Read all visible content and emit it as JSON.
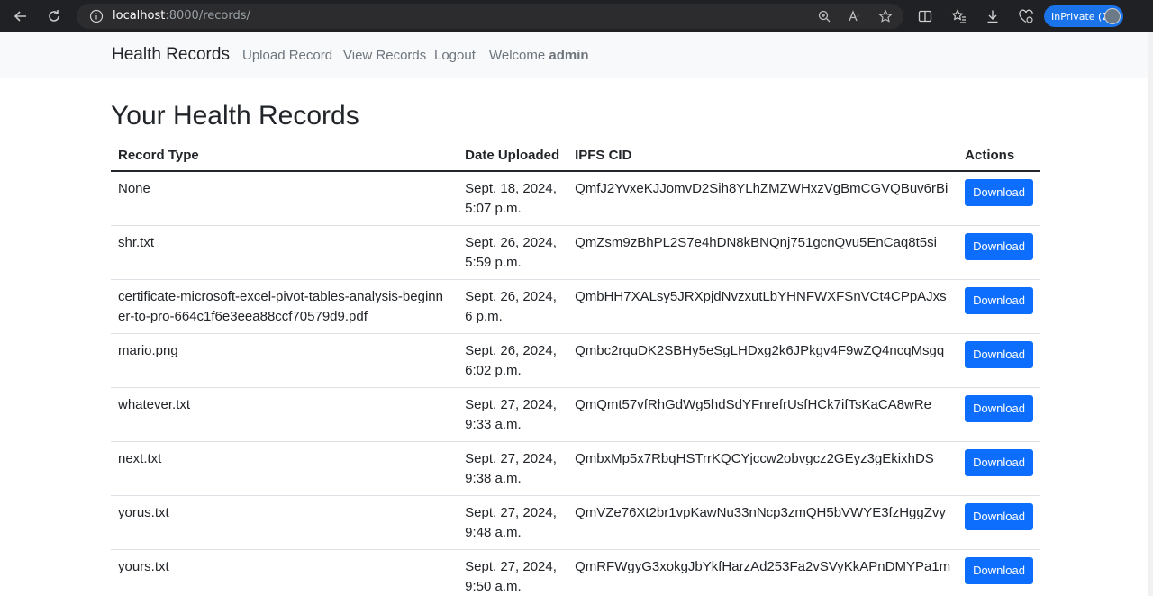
{
  "browser": {
    "url_host": "localhost",
    "url_rest": ":8000/records/",
    "inprivate_label": "InPrivate (2)"
  },
  "navbar": {
    "brand": "Health Records",
    "links": [
      "Upload Record",
      "View Records",
      "Logout"
    ],
    "welcome_prefix": "Welcome",
    "username": "admin"
  },
  "page": {
    "title": "Your Health Records"
  },
  "table": {
    "headers": [
      "Record Type",
      "Date Uploaded",
      "IPFS CID",
      "Actions"
    ],
    "rows": [
      {
        "record_type": "None",
        "date": "Sept. 18, 2024, 5:07 p.m.",
        "cid": "QmfJ2YvxeKJJomvD2Sih8YLhZMZWHxzVgBmCGVQBuv6rBi",
        "action": "Download"
      },
      {
        "record_type": "shr.txt",
        "date": "Sept. 26, 2024, 5:59 p.m.",
        "cid": "QmZsm9zBhPL2S7e4hDN8kBNQnj751gcnQvu5EnCaq8t5si",
        "action": "Download"
      },
      {
        "record_type": "certificate-microsoft-excel-pivot-tables-analysis-beginner-to-pro-664c1f6e3eea88ccf70579d9.pdf",
        "date": "Sept. 26, 2024, 6 p.m.",
        "cid": "QmbHH7XALsy5JRXpjdNvzxutLbYHNFWXFSnVCt4CPpAJxs",
        "action": "Download"
      },
      {
        "record_type": "mario.png",
        "date": "Sept. 26, 2024, 6:02 p.m.",
        "cid": "Qmbc2rquDK2SBHy5eSgLHDxg2k6JPkgv4F9wZQ4ncqMsgq",
        "action": "Download"
      },
      {
        "record_type": "whatever.txt",
        "date": "Sept. 27, 2024, 9:33 a.m.",
        "cid": "QmQmt57vfRhGdWg5hdSdYFnrefrUsfHCk7ifTsKaCA8wRe",
        "action": "Download"
      },
      {
        "record_type": "next.txt",
        "date": "Sept. 27, 2024, 9:38 a.m.",
        "cid": "QmbxMp5x7RbqHSTrrKQCYjccw2obvgcz2GEyz3gEkixhDS",
        "action": "Download"
      },
      {
        "record_type": "yorus.txt",
        "date": "Sept. 27, 2024, 9:48 a.m.",
        "cid": "QmVZe76Xt2br1vpKawNu33nNcp3zmQH5bVWYE3fzHggZvy",
        "action": "Download"
      },
      {
        "record_type": "yours.txt",
        "date": "Sept. 27, 2024, 9:50 a.m.",
        "cid": "QmRFWgyG3xokgJbYkfHarzAd253Fa2vSVyKkAPnDMYPa1m",
        "action": "Download"
      }
    ]
  },
  "colors": {
    "accent": "#0d6efd",
    "navbar_bg": "#f8f9fa",
    "chrome_bg": "#202124"
  }
}
